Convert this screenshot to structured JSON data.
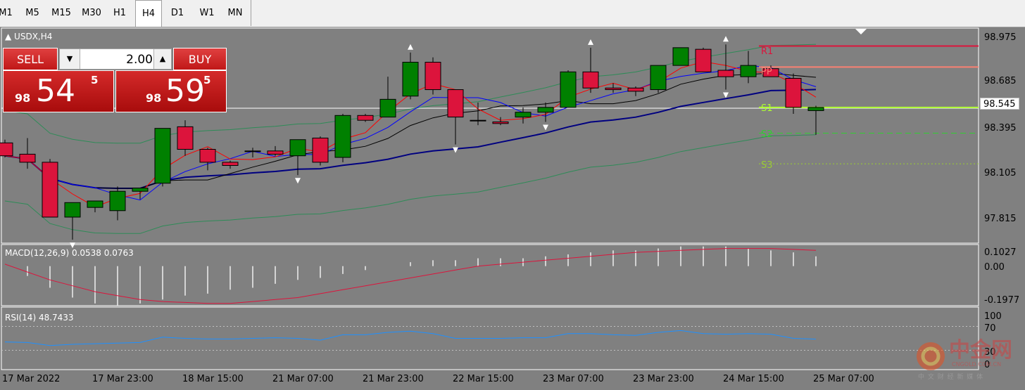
{
  "timeframes": [
    "M1",
    "M5",
    "M15",
    "M30",
    "H1",
    "H4",
    "D1",
    "W1",
    "MN"
  ],
  "active_timeframe": "H4",
  "symbol_label": "USDX,H4",
  "trade_panel": {
    "sell_label": "SELL",
    "buy_label": "BUY",
    "volume": "2.00",
    "sell_price": {
      "small": "98",
      "big": "54",
      "sup": "5"
    },
    "buy_price": {
      "small": "98",
      "big": "59",
      "sup": "5"
    }
  },
  "price_axis": [
    "98.975",
    "98.685",
    "98.395",
    "98.105",
    "97.815"
  ],
  "current_price": "98.545",
  "pivot_labels": {
    "r1": "R1",
    "pp": "PP",
    "s1": "S1",
    "s2": "S2",
    "s3": "S3"
  },
  "macd": {
    "label": "MACD(12,26,9) 0.0538 0.0763",
    "axis": [
      "0.1027",
      "0.00",
      "-0.1977"
    ]
  },
  "rsi": {
    "label": "RSI(14) 48.7433",
    "axis": [
      "100",
      "70",
      "30",
      "0"
    ]
  },
  "time_axis": [
    "17 Mar 2022",
    "17 Mar 23:00",
    "18 Mar 15:00",
    "21 Mar 07:00",
    "21 Mar 23:00",
    "22 Mar 15:00",
    "23 Mar 07:00",
    "23 Mar 23:00",
    "24 Mar 15:00",
    "25 Mar 07:00"
  ],
  "watermark": {
    "text": "中金网",
    "sub": "CNGOLD.COM.CN",
    "tagline": "中 文 财 经 新 媒 体"
  },
  "colors": {
    "bull": "#008000",
    "bear": "#dc143c",
    "bg": "#808080",
    "r1": "#dc143c",
    "pp": "#fa8072",
    "s1": "#adff2f",
    "s2": "#32cd32",
    "s3": "#9acd32"
  },
  "chart_data": {
    "type": "candlestick",
    "symbol": "USDX",
    "timeframe": "H4",
    "ylim": [
      97.7,
      99.05
    ],
    "candles": [
      {
        "o": 98.33,
        "h": 98.35,
        "l": 98.24,
        "c": 98.25
      },
      {
        "o": 98.26,
        "h": 98.36,
        "l": 98.17,
        "c": 98.21
      },
      {
        "o": 98.21,
        "h": 98.23,
        "l": 97.87,
        "c": 97.87
      },
      {
        "o": 97.87,
        "h": 97.96,
        "l": 97.73,
        "c": 97.96
      },
      {
        "o": 97.93,
        "h": 97.97,
        "l": 97.9,
        "c": 97.97
      },
      {
        "o": 97.91,
        "h": 98.06,
        "l": 97.85,
        "c": 98.03
      },
      {
        "o": 98.03,
        "h": 98.05,
        "l": 97.98,
        "c": 98.05
      },
      {
        "o": 98.08,
        "h": 98.32,
        "l": 98.06,
        "c": 98.42
      },
      {
        "o": 98.43,
        "h": 98.47,
        "l": 98.25,
        "c": 98.29
      },
      {
        "o": 98.29,
        "h": 98.3,
        "l": 98.16,
        "c": 98.21
      },
      {
        "o": 98.21,
        "h": 98.22,
        "l": 98.17,
        "c": 98.19
      },
      {
        "o": 98.28,
        "h": 98.3,
        "l": 98.24,
        "c": 98.28
      },
      {
        "o": 98.28,
        "h": 98.31,
        "l": 98.25,
        "c": 98.26
      },
      {
        "o": 98.25,
        "h": 98.33,
        "l": 98.13,
        "c": 98.35
      },
      {
        "o": 98.36,
        "h": 98.37,
        "l": 98.19,
        "c": 98.21
      },
      {
        "o": 98.24,
        "h": 98.51,
        "l": 98.21,
        "c": 98.5
      },
      {
        "o": 98.5,
        "h": 98.51,
        "l": 98.46,
        "c": 98.47
      },
      {
        "o": 98.49,
        "h": 98.74,
        "l": 98.49,
        "c": 98.6
      },
      {
        "o": 98.62,
        "h": 98.89,
        "l": 98.6,
        "c": 98.83
      },
      {
        "o": 98.83,
        "h": 98.86,
        "l": 98.63,
        "c": 98.66
      },
      {
        "o": 98.66,
        "h": 98.66,
        "l": 98.32,
        "c": 98.49
      },
      {
        "o": 98.47,
        "h": 98.58,
        "l": 98.44,
        "c": 98.47
      },
      {
        "o": 98.46,
        "h": 98.49,
        "l": 98.44,
        "c": 98.45
      },
      {
        "o": 98.49,
        "h": 98.55,
        "l": 98.45,
        "c": 98.52
      },
      {
        "o": 98.52,
        "h": 98.58,
        "l": 98.46,
        "c": 98.55
      },
      {
        "o": 98.55,
        "h": 98.78,
        "l": 98.55,
        "c": 98.77
      },
      {
        "o": 98.77,
        "h": 98.92,
        "l": 98.64,
        "c": 98.67
      },
      {
        "o": 98.67,
        "h": 98.7,
        "l": 98.64,
        "c": 98.66
      },
      {
        "o": 98.67,
        "h": 98.68,
        "l": 98.62,
        "c": 98.65
      },
      {
        "o": 98.66,
        "h": 98.81,
        "l": 98.64,
        "c": 98.81
      },
      {
        "o": 98.81,
        "h": 98.92,
        "l": 98.81,
        "c": 98.92
      },
      {
        "o": 98.91,
        "h": 98.92,
        "l": 98.77,
        "c": 98.77
      },
      {
        "o": 98.78,
        "h": 98.94,
        "l": 98.66,
        "c": 98.74
      },
      {
        "o": 98.74,
        "h": 98.9,
        "l": 98.7,
        "c": 98.81
      },
      {
        "o": 98.79,
        "h": 98.81,
        "l": 98.74,
        "c": 98.74
      },
      {
        "o": 98.73,
        "h": 98.76,
        "l": 98.51,
        "c": 98.55
      },
      {
        "o": 98.53,
        "h": 98.56,
        "l": 98.38,
        "c": 98.55
      }
    ],
    "pivots": {
      "r1": 98.93,
      "pp": 98.8,
      "s1": 98.55,
      "s2": 98.39,
      "s3": 98.2
    },
    "macd_hist": [
      0.0,
      -0.05,
      -0.11,
      -0.16,
      -0.19,
      -0.2,
      -0.19,
      -0.17,
      -0.15,
      -0.14,
      -0.12,
      -0.11,
      -0.09,
      -0.07,
      -0.06,
      -0.04,
      -0.02,
      0.0,
      0.02,
      0.03,
      0.03,
      0.04,
      0.04,
      0.04,
      0.05,
      0.06,
      0.07,
      0.08,
      0.08,
      0.09,
      0.1,
      0.1,
      0.1,
      0.09,
      0.08,
      0.07,
      0.05
    ],
    "macd_signal": [
      0.01,
      -0.03,
      -0.07,
      -0.1,
      -0.13,
      -0.15,
      -0.17,
      -0.18,
      -0.185,
      -0.19,
      -0.19,
      -0.18,
      -0.17,
      -0.16,
      -0.14,
      -0.12,
      -0.1,
      -0.08,
      -0.06,
      -0.04,
      -0.02,
      0.0,
      0.01,
      0.02,
      0.03,
      0.04,
      0.05,
      0.06,
      0.07,
      0.075,
      0.08,
      0.085,
      0.09,
      0.09,
      0.09,
      0.085,
      0.08
    ],
    "rsi": [
      44,
      43,
      38,
      40,
      41,
      42,
      43,
      52,
      50,
      49,
      49,
      50,
      51,
      50,
      47,
      56,
      56,
      60,
      62,
      58,
      50,
      50,
      50,
      51,
      51,
      58,
      58,
      56,
      55,
      60,
      63,
      58,
      57,
      58,
      57,
      50,
      48.7
    ]
  }
}
